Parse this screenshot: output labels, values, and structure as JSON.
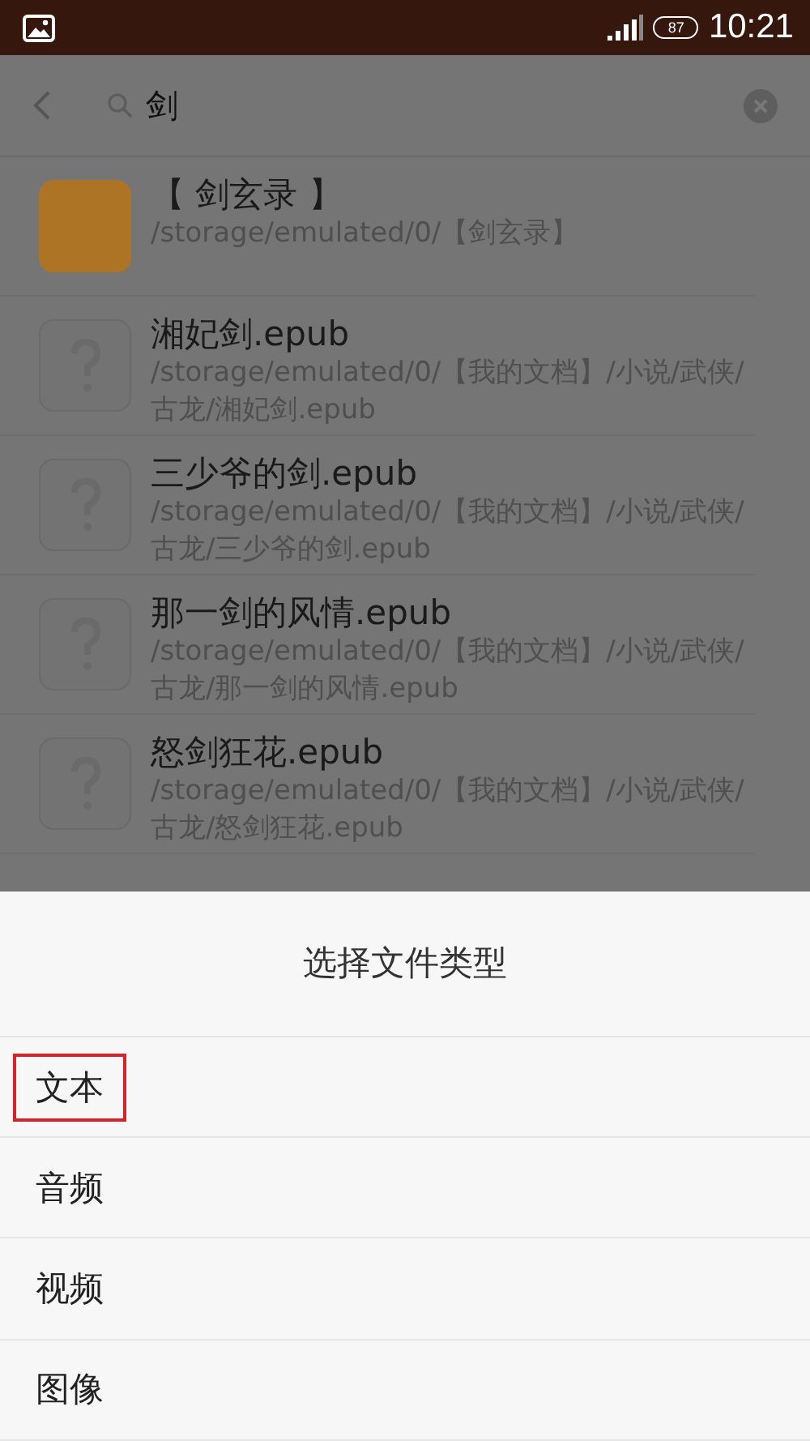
{
  "status_bar": {
    "battery": "87",
    "time": "10:21"
  },
  "search": {
    "value": "剑"
  },
  "results": [
    {
      "kind": "folder",
      "name": "【 剑玄录 】",
      "path": "/storage/emulated/0/【剑玄录】"
    },
    {
      "kind": "unknown",
      "name": "湘妃剑.epub",
      "path": "/storage/emulated/0/【我的文档】/小说/武侠/古龙/湘妃剑.epub"
    },
    {
      "kind": "unknown",
      "name": "三少爷的剑.epub",
      "path": "/storage/emulated/0/【我的文档】/小说/武侠/古龙/三少爷的剑.epub"
    },
    {
      "kind": "unknown",
      "name": "那一剑的风情.epub",
      "path": "/storage/emulated/0/【我的文档】/小说/武侠/古龙/那一剑的风情.epub"
    },
    {
      "kind": "unknown",
      "name": "怒剑狂花.epub",
      "path": "/storage/emulated/0/【我的文档】/小说/武侠/古龙/怒剑狂花.epub"
    }
  ],
  "sheet": {
    "title": "选择文件类型",
    "options": [
      {
        "label": "文本",
        "highlighted": true
      },
      {
        "label": "音频",
        "highlighted": false
      },
      {
        "label": "视频",
        "highlighted": false
      },
      {
        "label": "图像",
        "highlighted": false
      }
    ]
  }
}
